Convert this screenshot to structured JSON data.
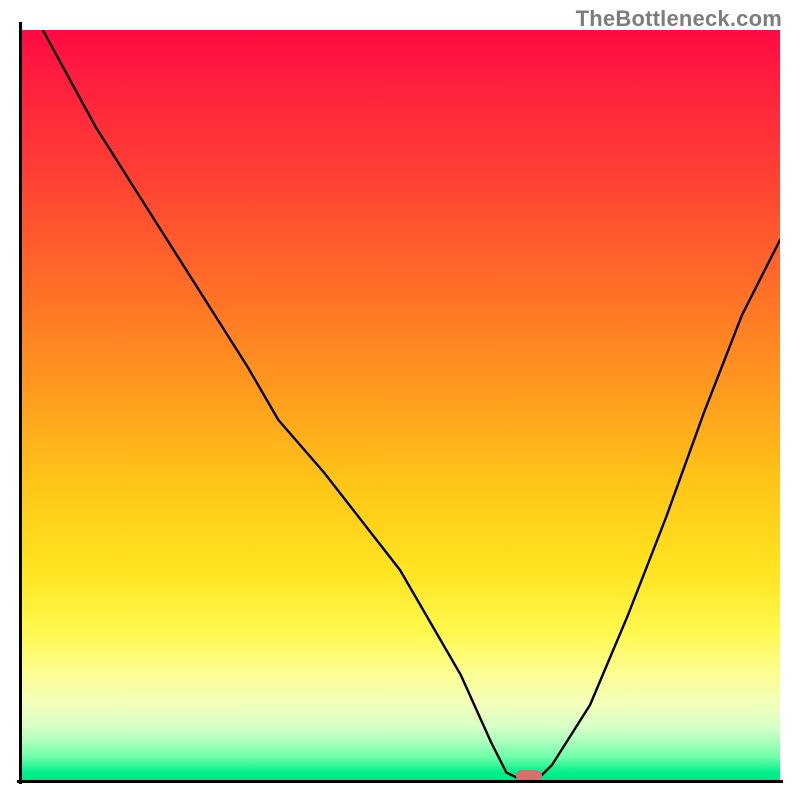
{
  "watermark": "TheBottleneck.com",
  "chart_data": {
    "type": "line",
    "title": "",
    "xlabel": "",
    "ylabel": "",
    "xlim": [
      0,
      100
    ],
    "ylim": [
      0,
      100
    ],
    "x": [
      0,
      3,
      10,
      20,
      30,
      34,
      40,
      50,
      58,
      62,
      64,
      66,
      68,
      70,
      75,
      80,
      85,
      90,
      95,
      100
    ],
    "values": [
      108,
      100,
      87,
      71,
      55,
      48,
      41,
      28,
      14,
      5,
      1,
      0,
      0,
      2,
      10,
      22,
      35,
      49,
      62,
      72
    ],
    "min_marker": {
      "x": 67,
      "y": 0
    },
    "marker_color": "#d6706f",
    "background": "rainbow-gradient"
  }
}
